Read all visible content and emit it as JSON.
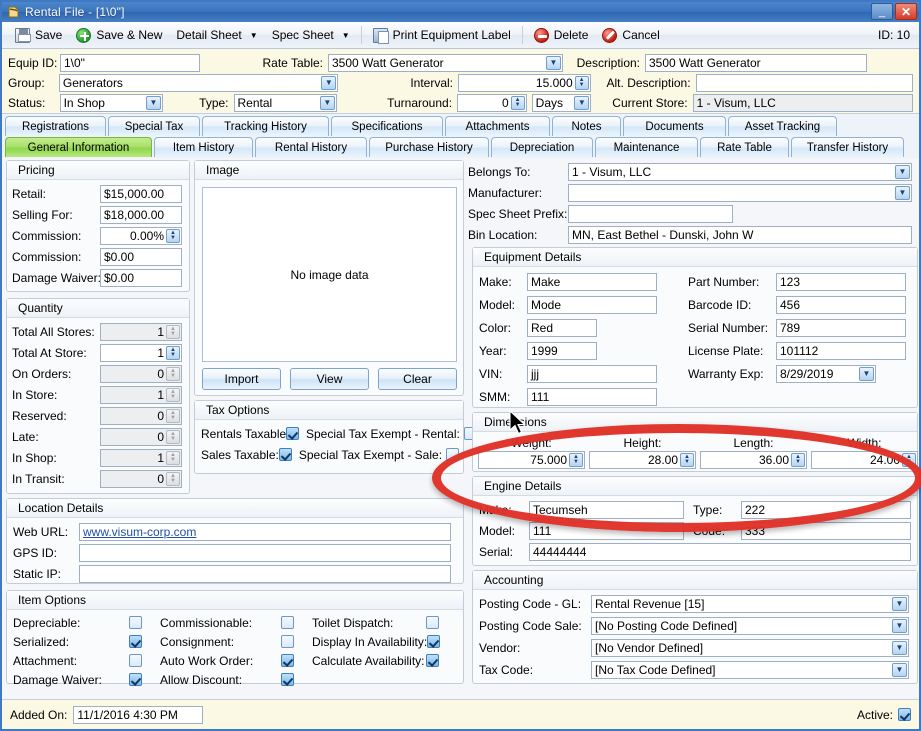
{
  "window": {
    "title": "Rental File - [1\\0\"]",
    "icon": "rental-file-icon",
    "minimize_label": "_",
    "close_label": "✕"
  },
  "toolbar": {
    "save": "Save",
    "save_and_new": "Save & New",
    "detail_sheet": "Detail Sheet",
    "spec_sheet": "Spec Sheet",
    "print_equipment_label": "Print Equipment Label",
    "delete": "Delete",
    "cancel": "Cancel",
    "record_id": "ID: 10",
    "caret": "▼"
  },
  "header": {
    "equip_id_label": "Equip ID:",
    "equip_id_value": "1\\0\"",
    "rate_table_label": "Rate Table:",
    "rate_table_value": "3500 Watt Generator",
    "description_label": "Description:",
    "description_value": "3500 Watt Generator",
    "group_label": "Group:",
    "group_value": "Generators",
    "interval_label": "Interval:",
    "interval_value": "15.000",
    "alt_description_label": "Alt. Description:",
    "alt_description_value": "",
    "status_label": "Status:",
    "status_value": "In Shop",
    "type_label": "Type:",
    "type_value": "Rental",
    "turnaround_label": "Turnaround:",
    "turnaround_value": "0",
    "turnaround_unit": "Days",
    "current_store_label": "Current Store:",
    "current_store_value": "1 - Visum, LLC"
  },
  "tabs": {
    "row1": [
      "Registrations",
      "Special Tax",
      "Tracking History",
      "Specifications",
      "Attachments",
      "Notes",
      "Documents",
      "Asset Tracking"
    ],
    "row2": [
      "General Information",
      "Item History",
      "Rental History",
      "Purchase History",
      "Depreciation",
      "Maintenance",
      "Rate Table",
      "Transfer History"
    ],
    "active": "General Information"
  },
  "pricing": {
    "title": "Pricing",
    "rows": [
      {
        "label": "Retail:",
        "value": "$15,000.00"
      },
      {
        "label": "Selling For:",
        "value": "$18,000.00"
      },
      {
        "label": "Commission:",
        "value": "0.00%"
      },
      {
        "label": "Commission:",
        "value": "$0.00"
      },
      {
        "label": "Damage Waiver:",
        "value": "$0.00"
      }
    ]
  },
  "quantity": {
    "title": "Quantity",
    "rows": [
      {
        "label": "Total All Stores:",
        "value": "1",
        "readonly": true
      },
      {
        "label": "Total At Store:",
        "value": "1",
        "readonly": false
      },
      {
        "label": "On Orders:",
        "value": "0",
        "readonly": true
      },
      {
        "label": "In Store:",
        "value": "1",
        "readonly": true
      },
      {
        "label": "Reserved:",
        "value": "0",
        "readonly": true
      },
      {
        "label": "Late:",
        "value": "0",
        "readonly": true
      },
      {
        "label": "In Shop:",
        "value": "1",
        "readonly": true
      },
      {
        "label": "In Transit:",
        "value": "0",
        "readonly": true
      }
    ]
  },
  "image_panel": {
    "title": "Image",
    "empty_text": "No image data",
    "import": "Import",
    "view": "View",
    "clear": "Clear"
  },
  "tax_options": {
    "title": "Tax Options",
    "rentals_taxable_label": "Rentals Taxable:",
    "rentals_taxable": true,
    "special_exempt_rental_label": "Special Tax Exempt - Rental:",
    "special_exempt_rental": false,
    "sales_taxable_label": "Sales Taxable:",
    "sales_taxable": true,
    "special_exempt_sale_label": "Special Tax Exempt - Sale:",
    "special_exempt_sale": false
  },
  "location_details": {
    "title": "Location Details",
    "web_url_label": "Web URL:",
    "web_url_value": "www.visum-corp.com",
    "gps_id_label": "GPS ID:",
    "gps_id_value": "",
    "static_ip_label": "Static IP:",
    "static_ip_value": ""
  },
  "item_options": {
    "title": "Item Options",
    "col1": [
      {
        "label": "Depreciable:",
        "checked": false
      },
      {
        "label": "Serialized:",
        "checked": true
      },
      {
        "label": "Attachment:",
        "checked": false
      },
      {
        "label": "Damage Waiver:",
        "checked": true
      }
    ],
    "col2": [
      {
        "label": "Commissionable:",
        "checked": false
      },
      {
        "label": "Consignment:",
        "checked": false
      },
      {
        "label": "Auto Work Order:",
        "checked": true
      },
      {
        "label": "Allow Discount:",
        "checked": true
      }
    ],
    "col3": [
      {
        "label": "Toilet Dispatch:",
        "checked": false
      },
      {
        "label": "Display In Availability:",
        "checked": true
      },
      {
        "label": "Calculate Availability:",
        "checked": true
      }
    ]
  },
  "ownership": {
    "belongs_to_label": "Belongs To:",
    "belongs_to_value": "1 - Visum, LLC",
    "manufacturer_label": "Manufacturer:",
    "manufacturer_value": "",
    "spec_sheet_prefix_label": "Spec Sheet Prefix:",
    "spec_sheet_prefix_value": "",
    "bin_location_label": "Bin Location:",
    "bin_location_value": "MN, East Bethel - Dunski, John W"
  },
  "equipment_details": {
    "title": "Equipment Details",
    "left": [
      {
        "label": "Make:",
        "value": "Make"
      },
      {
        "label": "Model:",
        "value": "Mode"
      },
      {
        "label": "Color:",
        "value": "Red"
      },
      {
        "label": "Year:",
        "value": "1999"
      },
      {
        "label": "VIN:",
        "value": "jjj"
      },
      {
        "label": "SMM:",
        "value": "111"
      }
    ],
    "right": [
      {
        "label": "Part Number:",
        "value": "123"
      },
      {
        "label": "Barcode ID:",
        "value": "456"
      },
      {
        "label": "Serial Number:",
        "value": "789"
      },
      {
        "label": "License Plate:",
        "value": "101112"
      },
      {
        "label": "Warranty Exp:",
        "value": "8/29/2019"
      }
    ]
  },
  "dimensions": {
    "title": "Dimensions",
    "fields": [
      {
        "label": "Weight:",
        "value": "75.000"
      },
      {
        "label": "Height:",
        "value": "28.00"
      },
      {
        "label": "Length:",
        "value": "36.00"
      },
      {
        "label": "Width:",
        "value": "24.00"
      }
    ]
  },
  "engine_details": {
    "title": "Engine Details",
    "make_label": "Make:",
    "make_value": "Tecumseh",
    "type_label": "Type:",
    "type_value": "222",
    "model_label": "Model:",
    "model_value": "111",
    "code_label": "Code:",
    "code_value": "333",
    "serial_label": "Serial:",
    "serial_value": "44444444"
  },
  "accounting": {
    "title": "Accounting",
    "rows": [
      {
        "label": "Posting Code - GL:",
        "value": "Rental Revenue [15]"
      },
      {
        "label": "Posting Code Sale:",
        "value": "[No Posting Code Defined]"
      },
      {
        "label": "Vendor:",
        "value": "[No Vendor Defined]"
      },
      {
        "label": "Tax Code:",
        "value": "[No Tax Code Defined]"
      }
    ]
  },
  "statusbar": {
    "added_on_label": "Added On:",
    "added_on_value": "11/1/2016 4:30 PM",
    "active_label": "Active:",
    "active": true
  },
  "annotation": {
    "highlight_color": "#e03127",
    "shape": "ellipse",
    "target": "dimensions-group"
  }
}
